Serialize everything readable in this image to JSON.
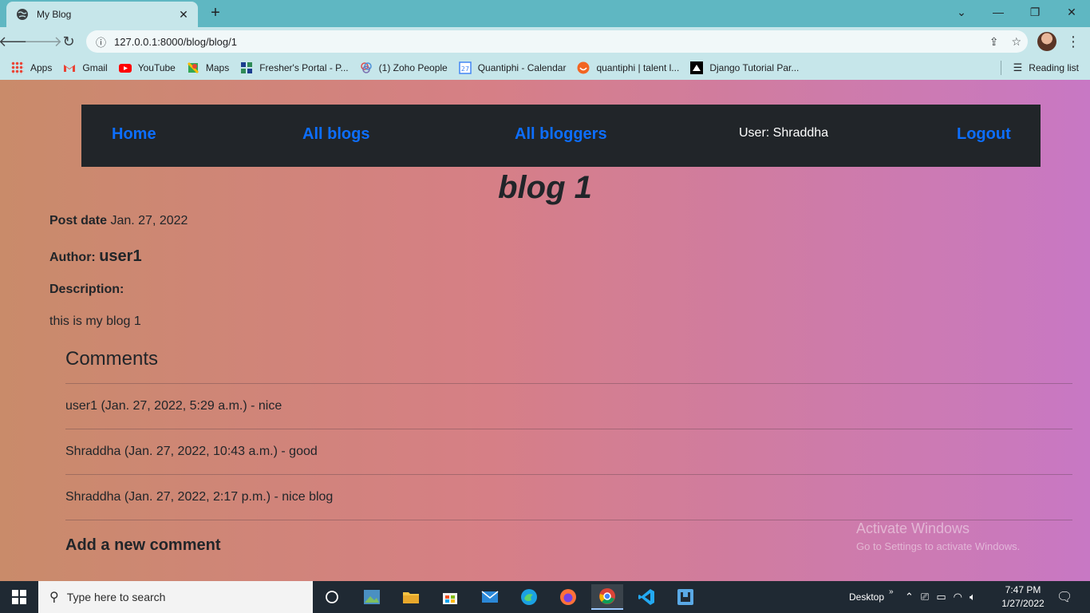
{
  "browser": {
    "tab_title": "My Blog",
    "url": "127.0.0.1:8000/blog/blog/1",
    "bookmarks": [
      {
        "label": "Apps",
        "icon": "apps-grid-icon",
        "color": "#ea4335"
      },
      {
        "label": "Gmail",
        "icon": "gmail-icon",
        "color": "#ea4335"
      },
      {
        "label": "YouTube",
        "icon": "youtube-icon",
        "color": "#ff0000"
      },
      {
        "label": "Maps",
        "icon": "maps-icon",
        "color": "#34a853"
      },
      {
        "label": "Fresher's Portal - P...",
        "icon": "portal-icon",
        "color": "#1a3d8f"
      },
      {
        "label": "(1) Zoho People",
        "icon": "zoho-icon",
        "color": "#7a6fb0"
      },
      {
        "label": "Quantiphi - Calendar",
        "icon": "calendar-icon",
        "color": "#4285f4"
      },
      {
        "label": "quantiphi | talent l...",
        "icon": "talent-icon",
        "color": "#f26522"
      },
      {
        "label": "Django Tutorial Par...",
        "icon": "mdn-icon",
        "color": "#000000"
      }
    ],
    "reading_list": "Reading list"
  },
  "nav": {
    "home": "Home",
    "all_blogs": "All blogs",
    "all_bloggers": "All bloggers",
    "user": "User: Shraddha",
    "logout": "Logout"
  },
  "blog": {
    "title": "blog 1",
    "post_date_label": "Post date",
    "post_date": "Jan. 27, 2022",
    "author_label": "Author:",
    "author": "user1",
    "description_label": "Description:",
    "description": "this is my blog 1"
  },
  "comments": {
    "heading": "Comments",
    "items": [
      "user1 (Jan. 27, 2022, 5:29 a.m.) - nice",
      "Shraddha (Jan. 27, 2022, 10:43 a.m.) - good",
      "Shraddha (Jan. 27, 2022, 2:17 p.m.) - nice blog"
    ],
    "add_new": "Add a new comment"
  },
  "watermark": {
    "line1": "Activate Windows",
    "line2": "Go to Settings to activate Windows."
  },
  "taskbar": {
    "search_placeholder": "Type here to search",
    "desktop_label": "Desktop",
    "time": "7:47 PM",
    "date": "1/27/2022"
  },
  "colors": {
    "nav_bg": "#212529",
    "nav_link": "#0d6efd",
    "gradient_left": "#c98b6a",
    "gradient_right": "#c878c4"
  }
}
